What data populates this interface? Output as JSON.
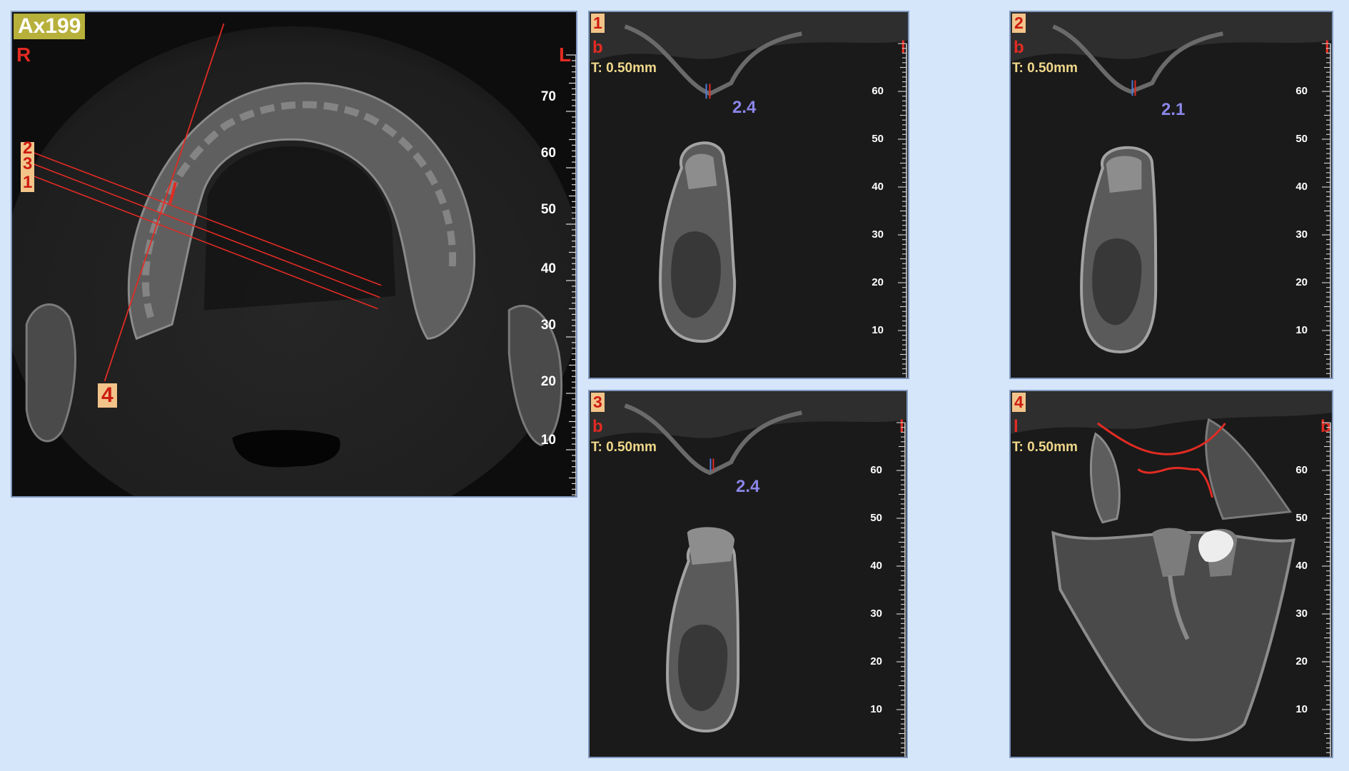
{
  "axial": {
    "title": "Ax199",
    "orient_right": "R",
    "orient_left": "L",
    "slice_labels": [
      "2",
      "3",
      "1"
    ],
    "slice4_label": "4",
    "ruler_labels": [
      "70",
      "60",
      "50",
      "40",
      "30",
      "20",
      "10"
    ]
  },
  "panels": [
    {
      "number": "1",
      "orient_top_left": "b",
      "orient_top_right": "l",
      "thickness": "T: 0.50mm",
      "measure": "2.4",
      "ruler_labels": [
        "60",
        "50",
        "40",
        "30",
        "20",
        "10"
      ]
    },
    {
      "number": "2",
      "orient_top_left": "b",
      "orient_top_right": "l",
      "thickness": "T: 0.50mm",
      "measure": "2.1",
      "ruler_labels": [
        "60",
        "50",
        "40",
        "30",
        "20",
        "10"
      ]
    },
    {
      "number": "3",
      "orient_top_left": "b",
      "orient_top_right": "l",
      "thickness": "T: 0.50mm",
      "measure": "2.4",
      "ruler_labels": [
        "60",
        "50",
        "40",
        "30",
        "20",
        "10"
      ]
    },
    {
      "number": "4",
      "orient_top_left": "l",
      "orient_top_right": "b",
      "thickness": "T: 0.50mm",
      "measure": "",
      "ruler_labels": [
        "60",
        "50",
        "40",
        "30",
        "20",
        "10"
      ]
    }
  ],
  "colors": {
    "background": "#d6e6fa",
    "panel_border": "#7f98bd",
    "annotation_red": "#e22b22",
    "measure_blue": "#8a86e8",
    "thickness_yellow": "#f0d88a",
    "title_badge": "#b7b03b",
    "slice_badge": "#f2c48a"
  }
}
